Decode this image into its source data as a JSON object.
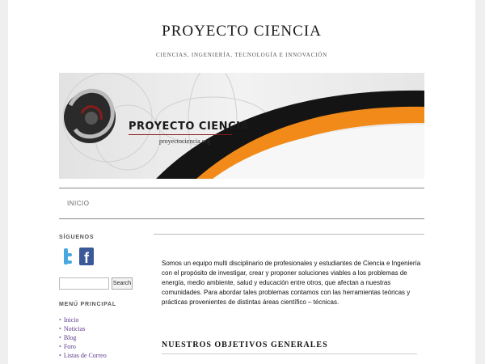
{
  "site": {
    "title": "PROYECTO CIENCIA",
    "description": "CIENCIAS, INGENIERÍA, TECNOLOGÍA E INNOVACIÓN"
  },
  "header": {
    "logo_text": "PROYECTO CIENCIA",
    "logo_url": "proyectociencia.org",
    "accent_orange": "#f28a1a",
    "accent_black": "#111111"
  },
  "nav": {
    "items": [
      "INICIO"
    ]
  },
  "sidebar": {
    "follow_title": "SÍGUENOS",
    "social": [
      "twitter-icon",
      "facebook-icon"
    ],
    "search_placeholder": "",
    "search_button": "Search",
    "menu_title": "MENÚ PRINCIPAL",
    "menu_items": [
      "Inicio",
      "Noticias",
      "Blog",
      "Foro",
      "Listas de Correo"
    ]
  },
  "content": {
    "intro": "Somos un equipo multi disciplinario de profesionales y estudiantes de Ciencia e Ingeniería con el propósito de investigar, crear y proponer soluciones viables a los problemas de energía, medio ambiente, salud y educación entre otros, que afectan a nuestras comunidades. Para abordar tales problemas contamos con las herramientas teóricas y prácticas provenientes de distintas áreas científico – técnicas.",
    "section_heading": "NUESTROS OBJETIVOS GENERALES"
  }
}
